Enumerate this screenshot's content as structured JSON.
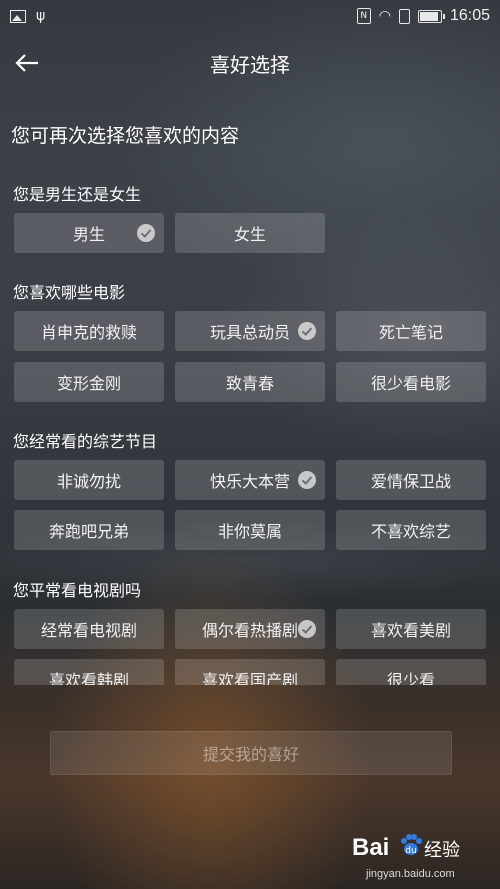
{
  "status_bar": {
    "time": "16:05",
    "left_icons": [
      "photo-icon",
      "usb-icon"
    ],
    "right_icons": [
      "nfc-icon",
      "wifi-icon",
      "sim-icon",
      "battery-icon"
    ]
  },
  "header": {
    "title": "喜好选择",
    "back_icon": "arrow-left-icon"
  },
  "intro": "您可再次选择您喜欢的内容",
  "sections": [
    {
      "title": "您是男生还是女生",
      "options": [
        {
          "label": "男生",
          "selected": true
        },
        {
          "label": "女生",
          "selected": false
        }
      ]
    },
    {
      "title": "您喜欢哪些电影",
      "options": [
        {
          "label": "肖申克的救赎",
          "selected": false
        },
        {
          "label": "玩具总动员",
          "selected": true
        },
        {
          "label": "死亡笔记",
          "selected": false
        },
        {
          "label": "变形金刚",
          "selected": false
        },
        {
          "label": "致青春",
          "selected": false
        },
        {
          "label": "很少看电影",
          "selected": false
        }
      ]
    },
    {
      "title": "您经常看的综艺节目",
      "options": [
        {
          "label": "非诚勿扰",
          "selected": false
        },
        {
          "label": "快乐大本营",
          "selected": true
        },
        {
          "label": "爱情保卫战",
          "selected": false
        },
        {
          "label": "奔跑吧兄弟",
          "selected": false
        },
        {
          "label": "非你莫属",
          "selected": false
        },
        {
          "label": "不喜欢综艺",
          "selected": false
        }
      ]
    },
    {
      "title": "您平常看电视剧吗",
      "options": [
        {
          "label": "经常看电视剧",
          "selected": false
        },
        {
          "label": "偶尔看热播剧",
          "selected": true
        },
        {
          "label": "喜欢看美剧",
          "selected": false
        },
        {
          "label": "喜欢看韩剧",
          "selected": false
        },
        {
          "label": "喜欢看国产剧",
          "selected": false
        },
        {
          "label": "很少看",
          "selected": false
        }
      ]
    }
  ],
  "submit_label": "提交我的喜好",
  "watermark": {
    "logo": "Bai",
    "brand": "经验",
    "url": "jingyan.baidu.com"
  }
}
